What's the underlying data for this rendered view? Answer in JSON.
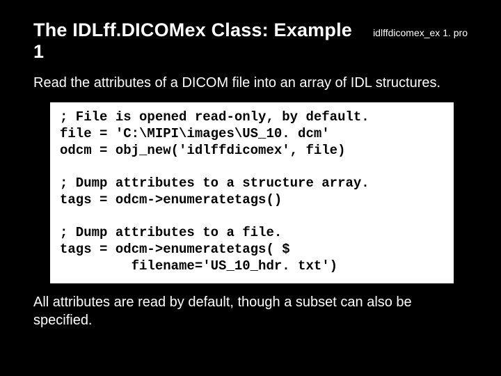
{
  "header": {
    "title": "The IDLff.DICOMex Class: Example 1",
    "filename": "idlffdicomex_ex 1. pro"
  },
  "intro": "Read the attributes of a DICOM file into an array of IDL structures.",
  "code": "; File is opened read-only, by default.\nfile = 'C:\\MIPI\\images\\US_10. dcm'\nodcm = obj_new('idlffdicomex', file)\n\n; Dump attributes to a structure array.\ntags = odcm->enumeratetags()\n\n; Dump attributes to a file.\ntags = odcm->enumeratetags( $\n         filename='US_10_hdr. txt')",
  "footer": "All attributes are read by default, though a subset can also be specified."
}
